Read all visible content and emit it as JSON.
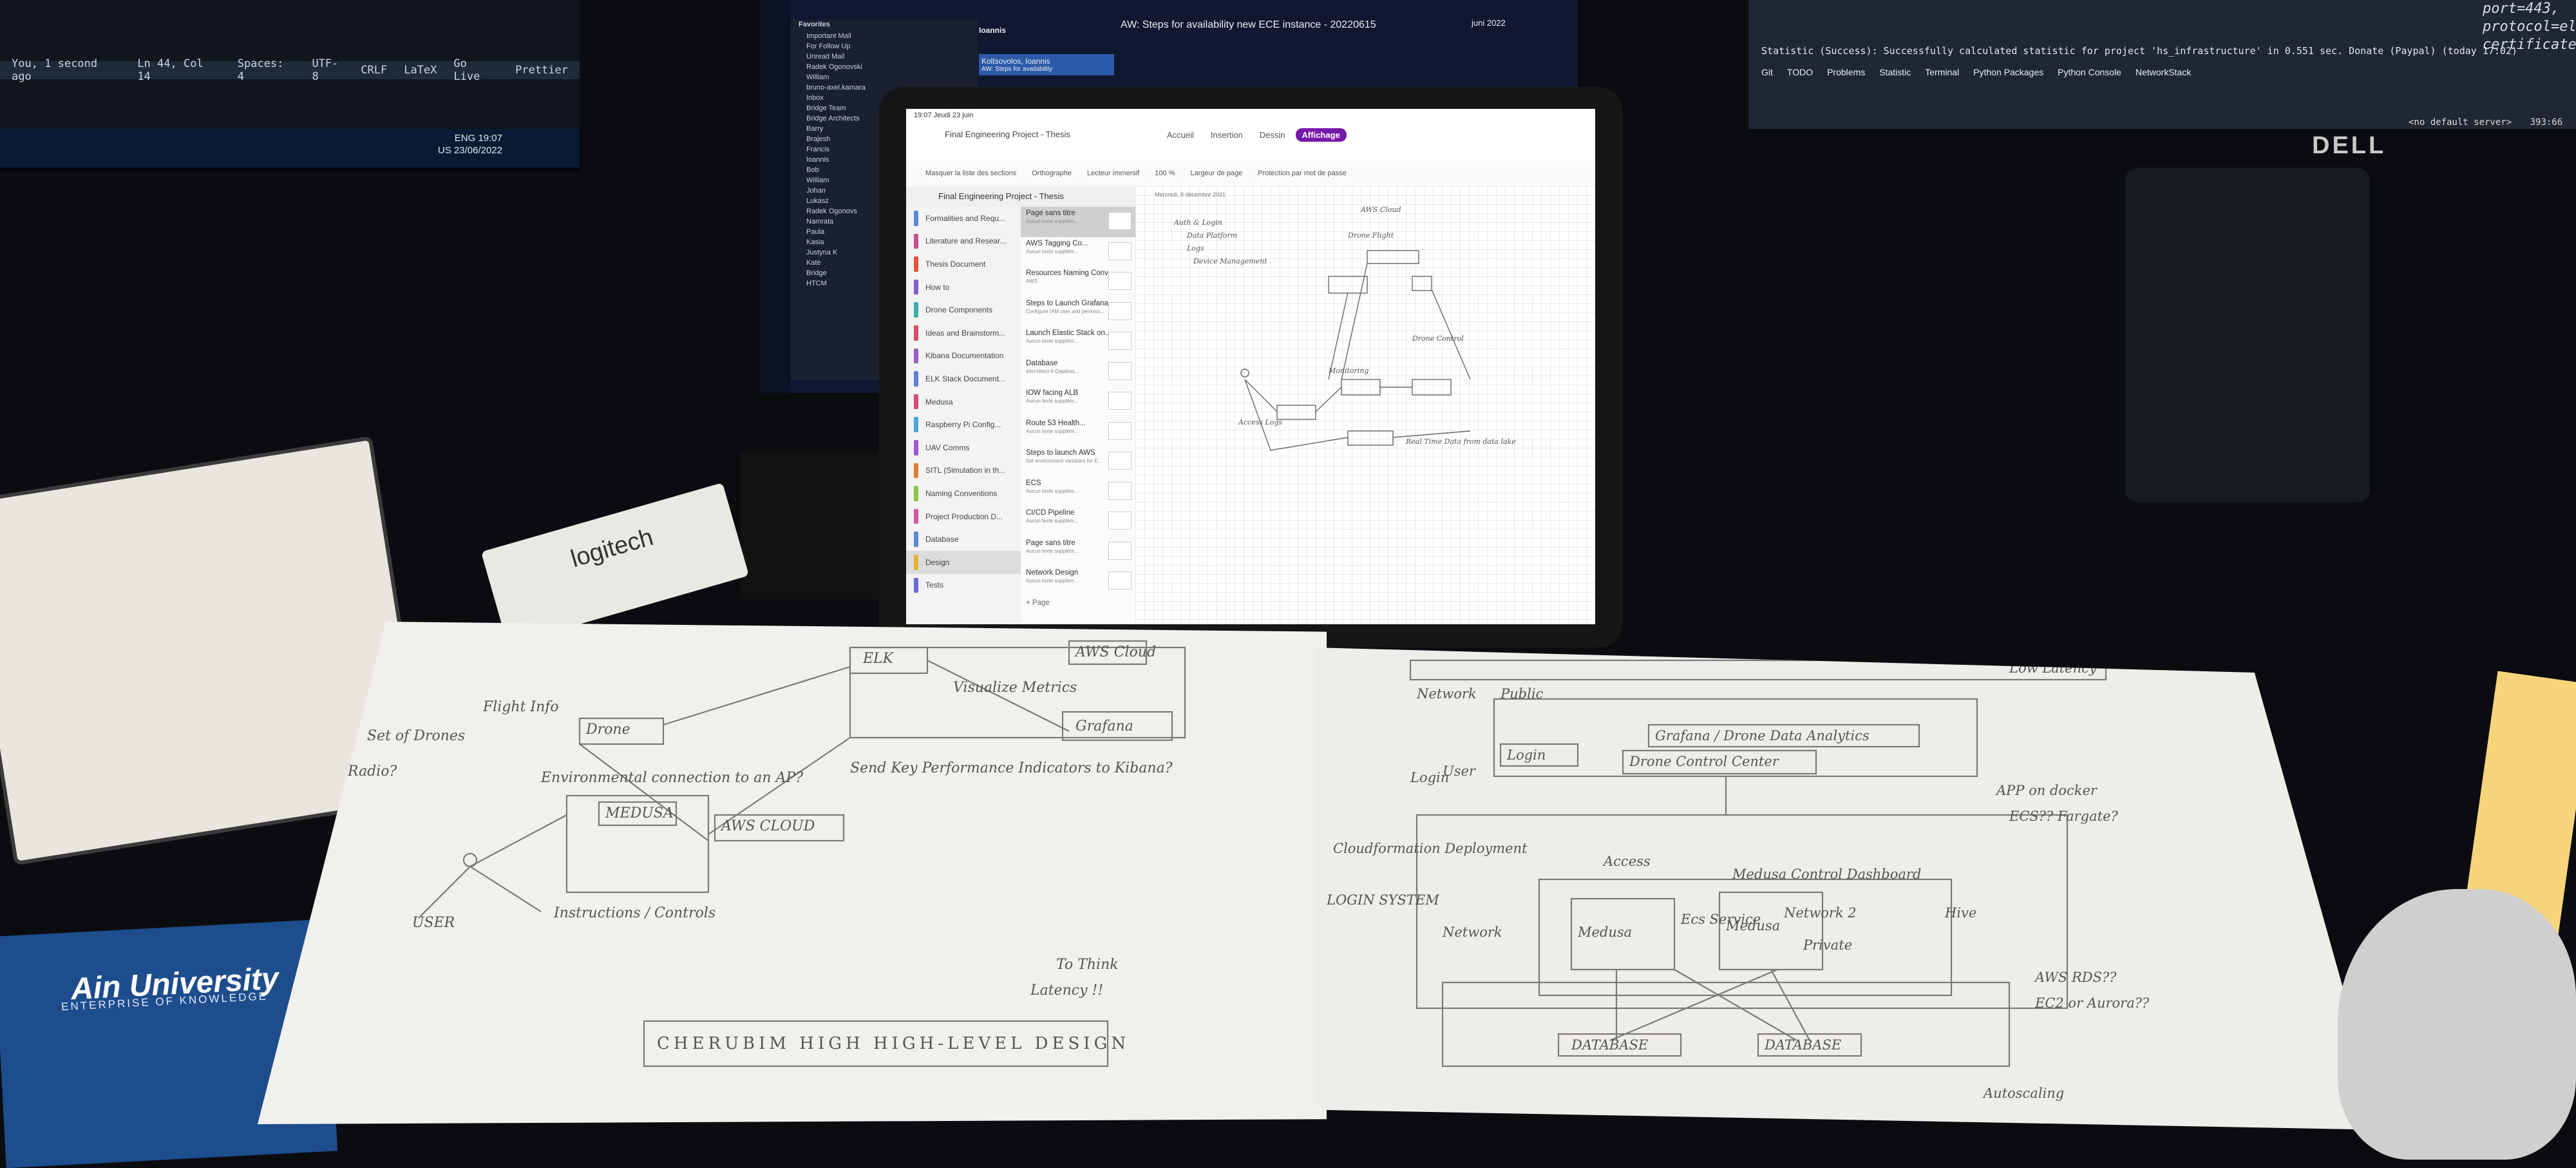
{
  "monitor_left": {
    "statusbar": [
      "You, 1 second ago",
      "Ln 44, Col 14",
      "Spaces: 4",
      "UTF-8",
      "CRLF",
      "LaTeX",
      "Go Live",
      "Prettier"
    ],
    "tray": {
      "lang": "ENG",
      "region": "US",
      "time": "19:07",
      "date": "23/06/2022"
    }
  },
  "monitor_center": {
    "folders_title": "Favorites",
    "folders": [
      "Important Mail",
      "For Follow Up",
      "Unread Mail",
      "Radek Ogonovski",
      "William",
      "bruno-axel.kamara",
      "Inbox",
      "Bridge Team",
      "Bridge Architects",
      "Barry",
      "Brajesh",
      "Francis",
      "Ioannis",
      "Bob",
      "William",
      "Johan",
      "Lukasz",
      "Radek Ogonovs",
      "Namrata",
      "Paula",
      "Kasia",
      "Justyna K",
      "Kate",
      "Bridge",
      "HTCM"
    ],
    "message_sender": "Ioannis",
    "message_list_item": "Koltsovolos, Ioannis",
    "message_preview": "AW: Steps for availability",
    "subject": "AW: Steps for availability new ECE instance - 20220615",
    "calendar_title": "juni 2022"
  },
  "monitor_right": {
    "status_text": "Statistic (Success): Successfully calculated statistic for project 'hs_infrastructure' in 0.551 sec. Donate (Paypal) (today 17:02)",
    "tabs": [
      "Git",
      "TODO",
      "Problems",
      "Statistic",
      "Terminal",
      "Python Packages",
      "Python Console",
      "NetworkStack"
    ],
    "code_lines": [
      "port=443,",
      "protocol=elb",
      "certificates="
    ],
    "dell_logo": "DELL",
    "server_status": "<no default server>",
    "server_meta": "393:66"
  },
  "onenote": {
    "time": "19:07 Jeudi 23 juin",
    "title": "Final Engineering Project - Thesis",
    "tabs": [
      "Accueil",
      "Insertion",
      "Dessin",
      "Affichage"
    ],
    "active_tab": "Affichage",
    "ribbon": [
      "Masquer la liste des sections",
      "Orthographe",
      "Lecteur immersif",
      "100 %",
      "Largeur de page",
      "Protection par mot de passe"
    ],
    "pane_title": "Final Engineering Project - Thesis",
    "sections": [
      {
        "label": "Formalities and Requ...",
        "color": "#5b8bd6"
      },
      {
        "label": "Literature and Resear...",
        "color": "#c84f8e"
      },
      {
        "label": "Thesis Document",
        "color": "#e0573b"
      },
      {
        "label": "How to",
        "color": "#7f5fc8"
      },
      {
        "label": "Drone Components",
        "color": "#3bb0a8"
      },
      {
        "label": "Ideas and Brainstorm...",
        "color": "#d94c6a"
      },
      {
        "label": "Kibana Documentation",
        "color": "#a15bc6"
      },
      {
        "label": "ELK Stack Document...",
        "color": "#5f7fd3"
      },
      {
        "label": "Medusa",
        "color": "#d64b7d"
      },
      {
        "label": "Raspberry Pi Config...",
        "color": "#49a7d8"
      },
      {
        "label": "UAV Comms",
        "color": "#9f5ad0"
      },
      {
        "label": "SITL (Simulation in th...",
        "color": "#e07d35"
      },
      {
        "label": "Naming Conventions",
        "color": "#8cc63f"
      },
      {
        "label": "Project Production D...",
        "color": "#d6569a"
      },
      {
        "label": "Database",
        "color": "#5b8bd6"
      },
      {
        "label": "Design",
        "color": "#e3b234"
      },
      {
        "label": "Tests",
        "color": "#6b6bd4"
      }
    ],
    "active_section": "Design",
    "pages": [
      {
        "title": "Page sans titre",
        "sub": "Aucun texte supplém..."
      },
      {
        "title": "AWS Tagging Co...",
        "sub": "Aucun texte supplém..."
      },
      {
        "title": "Resources Naming Conv...",
        "sub": "AWS"
      },
      {
        "title": "Steps to Launch Grafana...",
        "sub": "Configure IAM user and permiss..."
      },
      {
        "title": "Launch Elastic Stack on...",
        "sub": "Aucun texte supplém..."
      },
      {
        "title": "Database",
        "sub": "#Architect-fr-Databas..."
      },
      {
        "title": "IOW facing ALB",
        "sub": "Aucun texte supplém..."
      },
      {
        "title": "Route 53 Health...",
        "sub": "Aucun texte supplém..."
      },
      {
        "title": "Steps to launch AWS",
        "sub": "Set environment variables for E..."
      },
      {
        "title": "ECS",
        "sub": "Aucun texte supplém..."
      },
      {
        "title": "CI/CD Pipeline",
        "sub": "Aucun texte supplém..."
      },
      {
        "title": "Page sans titre",
        "sub": "Aucun texte supplém..."
      },
      {
        "title": "Network Design",
        "sub": "Aucun texte supplém..."
      }
    ],
    "add_page": "+ Page",
    "canvas_date": "Mercredi, 8 décembre 2021",
    "canvas_notes": [
      "Drone Flight",
      "Auth & Login",
      "Data Platform",
      "Logs",
      "AWS Cloud",
      "Drone Control",
      "Device Management",
      "Real Time Data from data lake",
      "Monitoring",
      "Access Logs"
    ]
  },
  "desk": {
    "logitech": "logitech",
    "book_title": "Ain University",
    "book_subtitle": "ENTERPRISE OF KNOWLEDGE"
  },
  "sketch_left": {
    "labels": [
      "ELK",
      "AWS Cloud",
      "Grafana",
      "Drone",
      "MEDUSA",
      "AWS CLOUD",
      "USER",
      "Flight Info",
      "Set of Drones",
      "Visualize Metrics",
      "Radio?",
      "Send Key Performance Indicators to Kibana?",
      "Environmental connection to an AP?",
      "Instructions / Controls",
      "To Think",
      "Latency !!"
    ],
    "title": "CHERUBIM HIGH HIGH-LEVEL DESIGN"
  },
  "sketch_right": {
    "labels": [
      "Network",
      "Public",
      "Grafana / Drone Data Analytics",
      "Drone Control Center",
      "Login",
      "Login",
      "User",
      "Cloudformation Deployment",
      "LOGIN SYSTEM",
      "Network",
      "Medusa Control Dashboard",
      "Network 2",
      "Private",
      "Medusa",
      "Medusa",
      "DATABASE",
      "DATABASE",
      "Low Latency",
      "APP on docker",
      "ECS?? Fargate?",
      "AWS RDS??",
      "EC2 or Aurora??",
      "Autoscaling",
      "Access",
      "Ecs Service",
      "Hive"
    ]
  }
}
